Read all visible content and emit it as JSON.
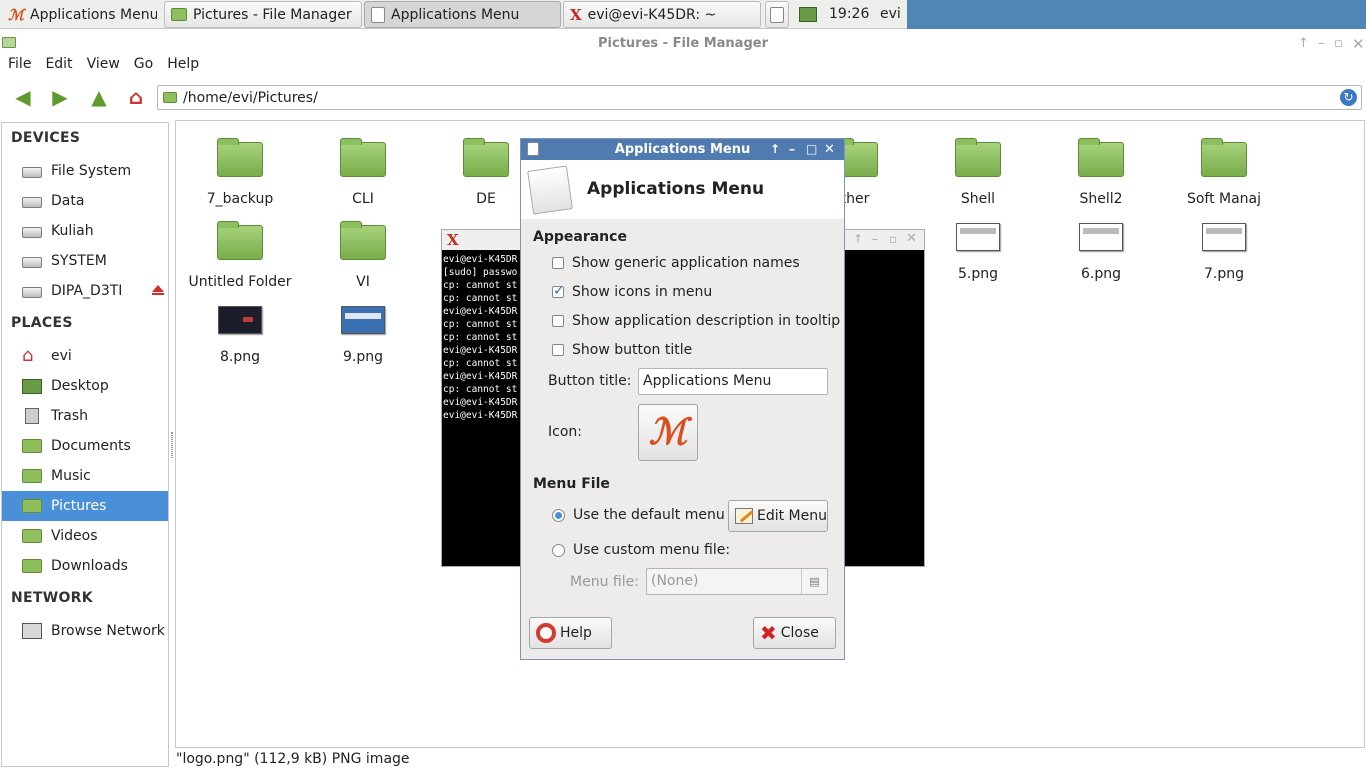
{
  "panel": {
    "buttons": [
      {
        "label": "Applications Menu",
        "icon": "xfce-logo-icon"
      },
      {
        "label": "Pictures - File Manager",
        "icon": "folder-icon"
      },
      {
        "label": "Applications Menu",
        "icon": "document-icon"
      },
      {
        "label": "evi@evi-K45DR: ~",
        "icon": "terminal-icon"
      }
    ],
    "clock": "19:26",
    "user": "evi"
  },
  "file_manager": {
    "title": "Pictures - File Manager",
    "menu": [
      "File",
      "Edit",
      "View",
      "Go",
      "Help"
    ],
    "path": "/home/evi/Pictures/",
    "sidebar": {
      "devices_header": "DEVICES",
      "devices": [
        "File System",
        "Data",
        "Kuliah",
        "SYSTEM",
        "DIPA_D3TI"
      ],
      "places_header": "PLACES",
      "places": [
        "evi",
        "Desktop",
        "Trash",
        "Documents",
        "Music",
        "Pictures",
        "Videos",
        "Downloads"
      ],
      "network_header": "NETWORK",
      "network": [
        "Browse Network"
      ],
      "selected": "Pictures"
    },
    "files": {
      "row1": [
        "7_backup",
        "CLI",
        "DE",
        "ther",
        "Shell",
        "Shell2",
        "Soft Manaj"
      ],
      "row2": [
        "Untitled Folder",
        "VI",
        "5.png",
        "6.png",
        "7.png"
      ],
      "row3": [
        "8.png",
        "9.png"
      ]
    },
    "status": "\"logo.png\" (112,9 kB) PNG image"
  },
  "terminal": {
    "lines": [
      "evi@evi-K45DR",
      "[sudo] passwo",
      "cp: cannot st",
      "cp: cannot st",
      "evi@evi-K45DR",
      "cp: cannot st",
      "cp: cannot st",
      "evi@evi-K45DR",
      "cp: cannot st",
      "evi@evi-K45DR",
      "cp: cannot st",
      "evi@evi-K45DR",
      "evi@evi-K45DR"
    ]
  },
  "dialog": {
    "title": "Applications Menu",
    "header": "Applications Menu",
    "appearance_header": "Appearance",
    "options": [
      {
        "label": "Show generic application names",
        "checked": false
      },
      {
        "label": "Show icons in menu",
        "checked": true
      },
      {
        "label": "Show application description in tooltip",
        "checked": false
      },
      {
        "label": "Show button title",
        "checked": false
      }
    ],
    "button_title_label": "Button title:",
    "button_title_value": "Applications Menu",
    "icon_label": "Icon:",
    "menu_file_header": "Menu File",
    "default_menu_label": "Use the default menu",
    "edit_menu_label": "Edit Menu",
    "custom_menu_label": "Use custom menu file:",
    "menu_file_label": "Menu file:",
    "menu_file_value": "(None)",
    "help_label": "Help",
    "close_label": "Close"
  },
  "colors": {
    "selection": "#4a90d9",
    "dialog_titlebar": "#4f7bb1",
    "folder_green": "#8fbf5c"
  }
}
